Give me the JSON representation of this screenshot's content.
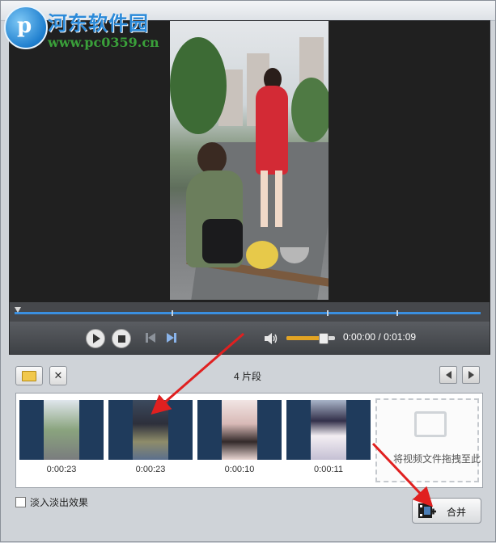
{
  "watermark": {
    "logo_letter": "p",
    "title": "河东软件园",
    "url": "www.pc0359.cn"
  },
  "player": {
    "current_time": "0:00:00",
    "total_time": "0:01:09",
    "time_separator": " / ",
    "volume": 0.75
  },
  "icons": {
    "play": "play-icon",
    "stop": "stop-icon",
    "prev": "previous-icon",
    "next": "next-icon",
    "volume": "speaker-icon",
    "open": "folder-icon",
    "remove": "close-icon",
    "left": "arrow-left-icon",
    "right": "arrow-right-icon",
    "merge": "film-merge-icon"
  },
  "segments": {
    "remove_label": "✕",
    "count_label": "4 片段",
    "clips": [
      {
        "duration": "0:00:23"
      },
      {
        "duration": "0:00:23"
      },
      {
        "duration": "0:00:10"
      },
      {
        "duration": "0:00:11"
      }
    ],
    "drop_hint": "将视频文件拖拽至此"
  },
  "options": {
    "fade_label": "淡入淡出效果",
    "fade_checked": false
  },
  "actions": {
    "merge_label": "合并"
  },
  "colors": {
    "accent": "#3a8fe0",
    "arrow": "#e02020",
    "volume": "#e3a423"
  }
}
